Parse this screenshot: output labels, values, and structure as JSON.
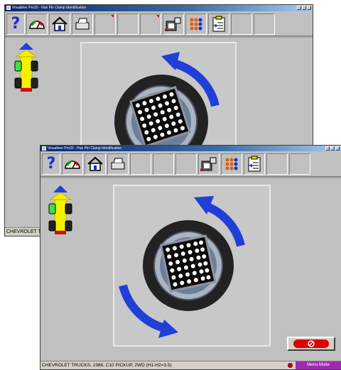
{
  "back_window": {
    "title": "Visualiner Pro32 - Hub Pin Clamp Identification",
    "status": "CHEVROLET TRUCKS, 1986, C10 PICKUP, 2WD (H1-H2=3.5)"
  },
  "front_window": {
    "title": "Visualiner Pro32 - Hub Pin Clamp Identification",
    "status": "CHEVROLET TRUCKS, 1986, C10 PICKUP, 2WD (H1-H2=3.5)",
    "menu_mode_label": "Menu Mode"
  },
  "toolbar_icons": [
    "help-icon",
    "gauge-icon",
    "home-icon",
    "printer-icon",
    "camera-target-icon",
    "dots-target-icon",
    "clipboard-icon"
  ],
  "colors": {
    "title_bar": "#0a246a",
    "arrow_blue": "#1f3fd8",
    "car_yellow": "#f5f000",
    "menu_mode": "#9d2bb0",
    "stop_red": "#e00000"
  }
}
